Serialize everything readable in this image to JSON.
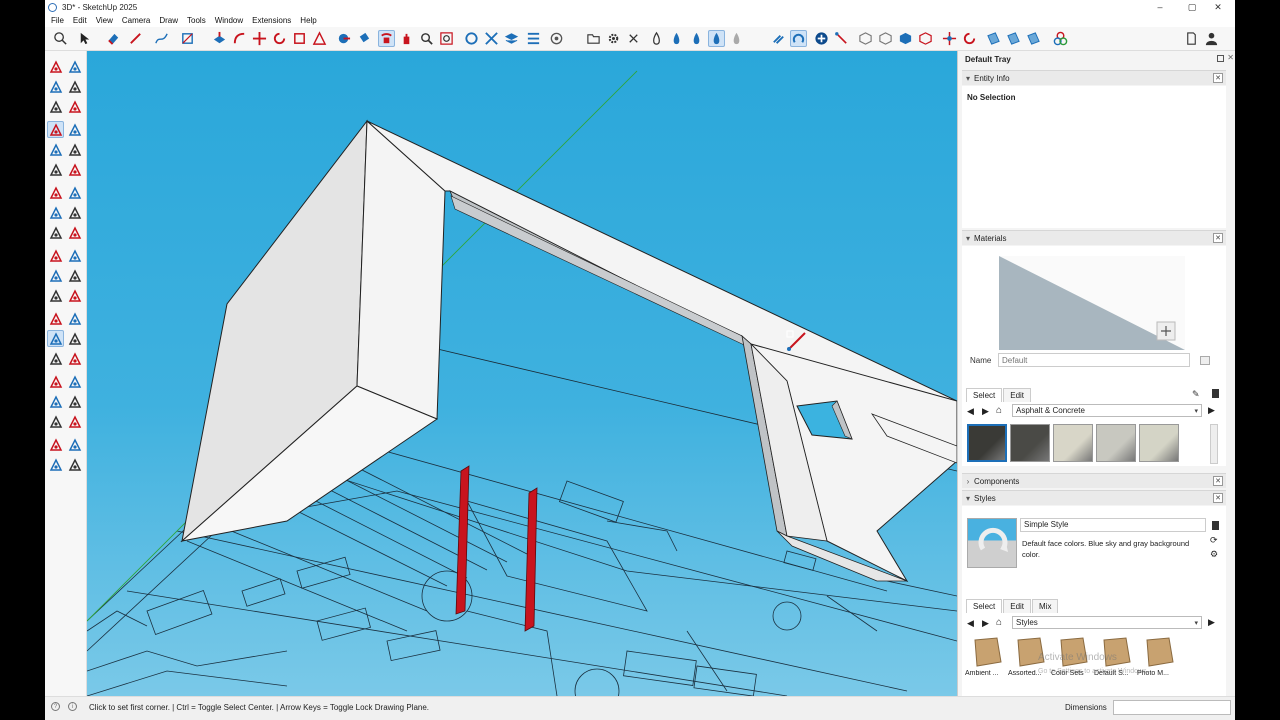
{
  "window": {
    "title": "3D* - SketchUp 2025",
    "minimize": "–",
    "restore": "▢",
    "close": "✕"
  },
  "menu": [
    "File",
    "Edit",
    "View",
    "Camera",
    "Draw",
    "Tools",
    "Window",
    "Extensions",
    "Help"
  ],
  "tray": {
    "title": "Default Tray",
    "entity_info": {
      "title": "Entity Info",
      "selection": "No Selection"
    },
    "materials": {
      "title": "Materials",
      "name_label": "Name",
      "name_placeholder": "Default",
      "tabs": [
        "Select",
        "Edit"
      ],
      "collection": "Asphalt & Concrete",
      "swatches": [
        "#3a3a36",
        "#4a4a46",
        "#d8d6c8",
        "#c8c8c0",
        "#d4d4c6"
      ]
    },
    "components": {
      "title": "Components"
    },
    "styles": {
      "title": "Styles",
      "style_name": "Simple Style",
      "description": "Default face colors. Blue sky and gray background color.",
      "tabs": [
        "Select",
        "Edit",
        "Mix"
      ],
      "collection": "Styles",
      "folders": [
        "Ambient ...",
        "Assorted...",
        "Color Sets",
        "Default S...",
        "Photo M..."
      ]
    }
  },
  "status": {
    "text": "Click to set first corner. | Ctrl = Toggle Select Center. | Arrow Keys = Toggle Lock Drawing Plane.",
    "vcb_label": "Dimensions",
    "vcb_value": ""
  },
  "watermark": {
    "title": "Activate Windows",
    "sub": "Go to Settings to activate Windows."
  },
  "colors": {
    "sky": "#2aa7da",
    "accent_red": "#c8141e",
    "selection_blue": "#cfe3f7"
  }
}
